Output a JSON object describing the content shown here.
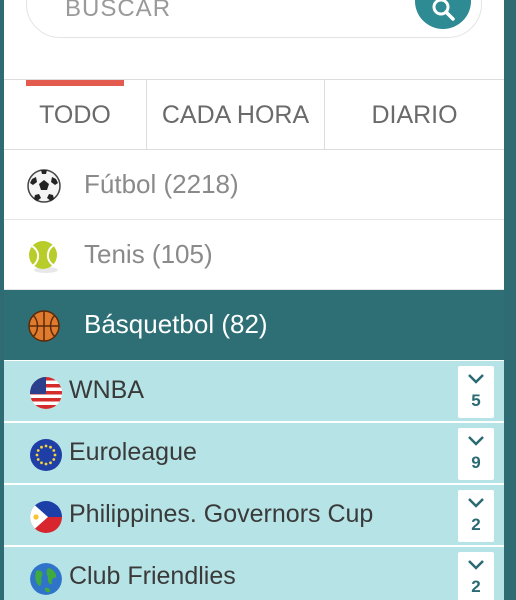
{
  "search": {
    "placeholder": "BUSCAR"
  },
  "tabs": [
    {
      "label": "TODO",
      "active": true
    },
    {
      "label": "CADA HORA",
      "active": false
    },
    {
      "label": "DIARIO",
      "active": false
    }
  ],
  "sports": [
    {
      "label": "Fútbol (2218)",
      "icon": "soccer-ball-icon"
    },
    {
      "label": "Tenis (105)",
      "icon": "tennis-ball-icon"
    },
    {
      "label": "Básquetbol (82)",
      "icon": "basketball-icon",
      "active": true
    }
  ],
  "leagues": [
    {
      "name": "WNBA",
      "count": "5",
      "flag": "usa-flag-icon"
    },
    {
      "name": "Euroleague",
      "count": "9",
      "flag": "eu-flag-icon"
    },
    {
      "name": "Philippines. Governors Cup",
      "count": "2",
      "flag": "philippines-flag-icon"
    },
    {
      "name": "Club Friendlies",
      "count": "2",
      "flag": "world-globe-icon"
    }
  ],
  "colors": {
    "accent_teal": "#2e6f76",
    "league_bg": "#b5e3e6",
    "tab_indicator": "#e35b4f"
  }
}
